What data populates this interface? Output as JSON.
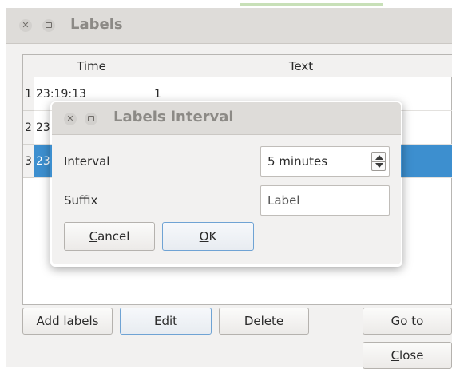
{
  "main_window": {
    "title": "Labels",
    "table": {
      "columns": [
        "Time",
        "Text"
      ],
      "rows": [
        {
          "num": "1",
          "time": "23:19:13",
          "text": "1"
        },
        {
          "num": "2",
          "time": "23",
          "text": ""
        },
        {
          "num": "3",
          "time": "23",
          "text": "",
          "selected": true
        }
      ]
    },
    "buttons": {
      "add_labels": "Add labels",
      "edit": "Edit",
      "delete": "Delete",
      "go_to": "Go to",
      "close_mnemonic": "C",
      "close_rest": "lose"
    }
  },
  "dialog": {
    "title": "Labels interval",
    "interval_label": "Interval",
    "interval_value": "5 minutes",
    "suffix_label": "Suffix",
    "suffix_placeholder": "Label",
    "cancel_mnemonic": "C",
    "cancel_rest": "ancel",
    "ok_mnemonic": "O",
    "ok_rest": "K"
  },
  "colors": {
    "selection": "#3d8fcf",
    "titlebar": "#dedcd9",
    "focus_border": "#6fa3d4"
  },
  "icons": {
    "close": "close-icon",
    "maximize": "maximize-icon",
    "spin_up": "spin-up-icon",
    "spin_down": "spin-down-icon"
  }
}
